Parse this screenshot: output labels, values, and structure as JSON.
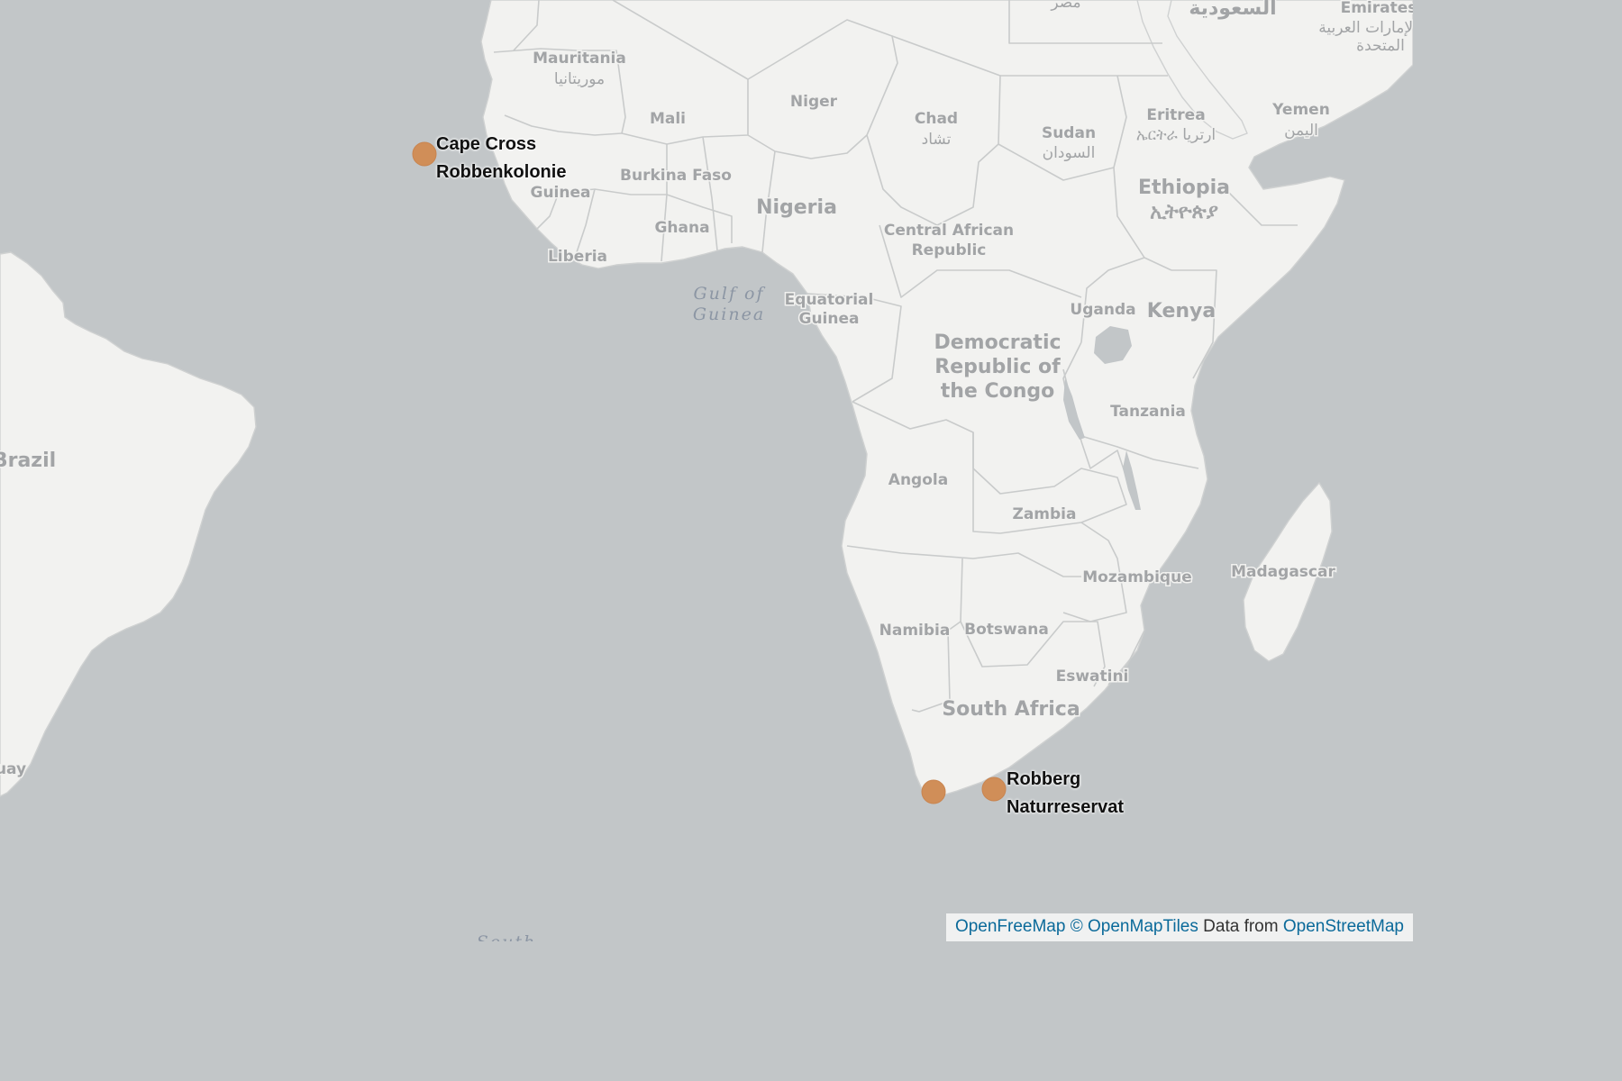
{
  "map": {
    "countries": {
      "mauritania": "Mauritania",
      "mauritania_native": "موريتانيا",
      "mali": "Mali",
      "niger": "Niger",
      "chad": "Chad",
      "chad_native": "تشاد",
      "sudan": "Sudan",
      "sudan_native": "السودان",
      "eritrea": "Eritrea",
      "eritrea_native": "ኤርትራ ارتريا",
      "yemen": "Yemen",
      "yemen_native": "اليمن",
      "egypt_native": "مصر",
      "saudi_native": "السعودية",
      "emirates": "Emirates",
      "emirates_native_1": "الإمارات العربية",
      "emirates_native_2": "المتحدة",
      "burkina_faso": "Burkina Faso",
      "guinea": "Guinea",
      "ghana": "Ghana",
      "nigeria": "Nigeria",
      "liberia": "Liberia",
      "ethiopia": "Ethiopia",
      "ethiopia_native": "ኢትዮጵያ",
      "car_1": "Central African",
      "car_2": "Republic",
      "eq_guinea_1": "Equatorial",
      "eq_guinea_2": "Guinea",
      "uganda": "Uganda",
      "kenya": "Kenya",
      "drc_1": "Democratic",
      "drc_2": "Republic of",
      "drc_3": "the Congo",
      "tanzania": "Tanzania",
      "angola": "Angola",
      "zambia": "Zambia",
      "mozambique": "Mozambique",
      "madagascar": "Madagascar",
      "namibia": "Namibia",
      "botswana": "Botswana",
      "eswatini": "Eswatini",
      "south_africa": "South Africa",
      "brazil": "Brazil",
      "uruguay_partial": "uay"
    },
    "seas": {
      "gulf_of_guinea_1": "Gulf of",
      "gulf_of_guinea_2": "Guinea",
      "south_partial": "South"
    },
    "colors": {
      "water": "#c2c6c8",
      "land": "#f2f2f0",
      "marker": "#d08e58"
    }
  },
  "markers": [
    {
      "label_line1": "Cape Cross",
      "label_line2": "Robbenkolonie"
    },
    {
      "label_line1": "",
      "label_line2": ""
    },
    {
      "label_line1": "Robberg",
      "label_line2": "Naturreservat"
    }
  ],
  "attribution": {
    "openfreemap": "OpenFreeMap",
    "openmaptiles": "© OpenMapTiles",
    "data_from": "Data from",
    "openstreetmap": "OpenStreetMap"
  }
}
